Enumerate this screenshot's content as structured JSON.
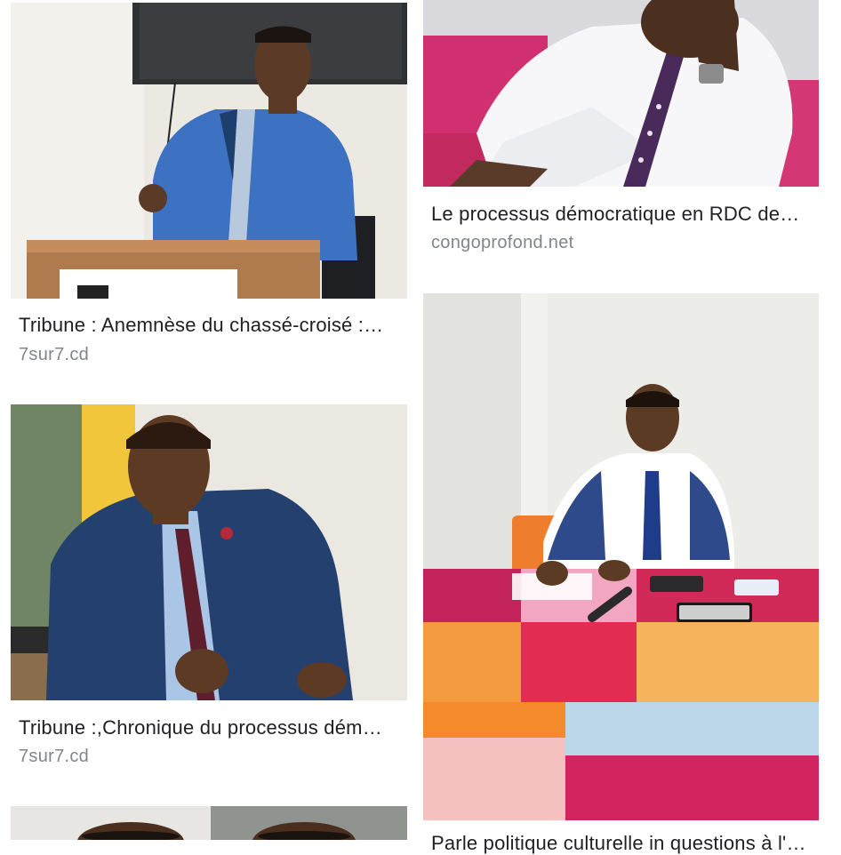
{
  "results": [
    {
      "title": "Tribune : Anemnèse du chassé-croisé :…",
      "source": "7sur7.cd"
    },
    {
      "title": "Le processus démocratique en RDC de…",
      "source": "congoprofond.net"
    },
    {
      "title": "Tribune :,Chronique du processus dém…",
      "source": "7sur7.cd"
    },
    {
      "title": "Parle politique culturelle in questions à l'é…",
      "source": ""
    },
    {
      "title": "",
      "source": ""
    }
  ]
}
